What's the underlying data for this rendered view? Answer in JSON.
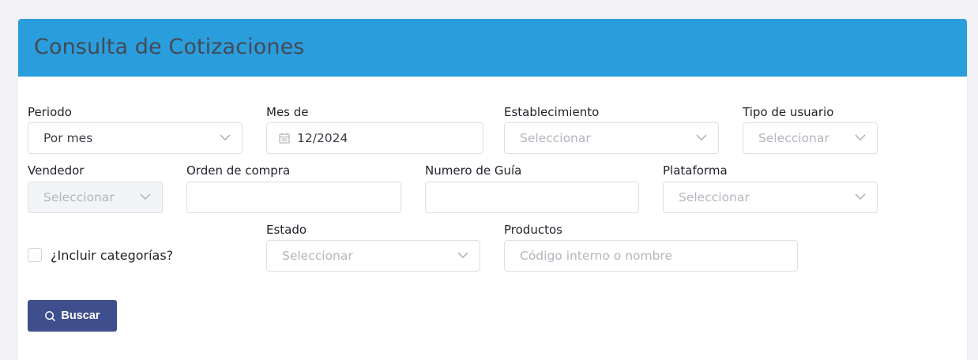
{
  "header": {
    "title": "Consulta de Cotizaciones",
    "color": "#2a9ddd"
  },
  "filters": {
    "periodo": {
      "label": "Periodo",
      "value": "Por mes",
      "icon": "chevron-down-icon"
    },
    "mes_de": {
      "label": "Mes de",
      "value": "12/2024",
      "icon": "calendar-icon"
    },
    "establecimiento": {
      "label": "Establecimiento",
      "placeholder": "Seleccionar"
    },
    "tipo_usuario": {
      "label": "Tipo de usuario",
      "placeholder": "Seleccionar"
    },
    "vendedor": {
      "label": "Vendedor",
      "placeholder": "Seleccionar",
      "disabled": true
    },
    "orden_compra": {
      "label": "Orden de compra",
      "value": ""
    },
    "numero_guia": {
      "label": "Numero de Guía",
      "value": ""
    },
    "plataforma": {
      "label": "Plataforma",
      "placeholder": "Seleccionar"
    },
    "incluir_categorias": {
      "label": "¿Incluir categorías?",
      "checked": false
    },
    "estado": {
      "label": "Estado",
      "placeholder": "Seleccionar"
    },
    "productos": {
      "label": "Productos",
      "placeholder": "Código interno o nombre"
    }
  },
  "actions": {
    "search_label": "Buscar",
    "search_icon": "search-icon",
    "button_color": "#3f4e8c"
  }
}
